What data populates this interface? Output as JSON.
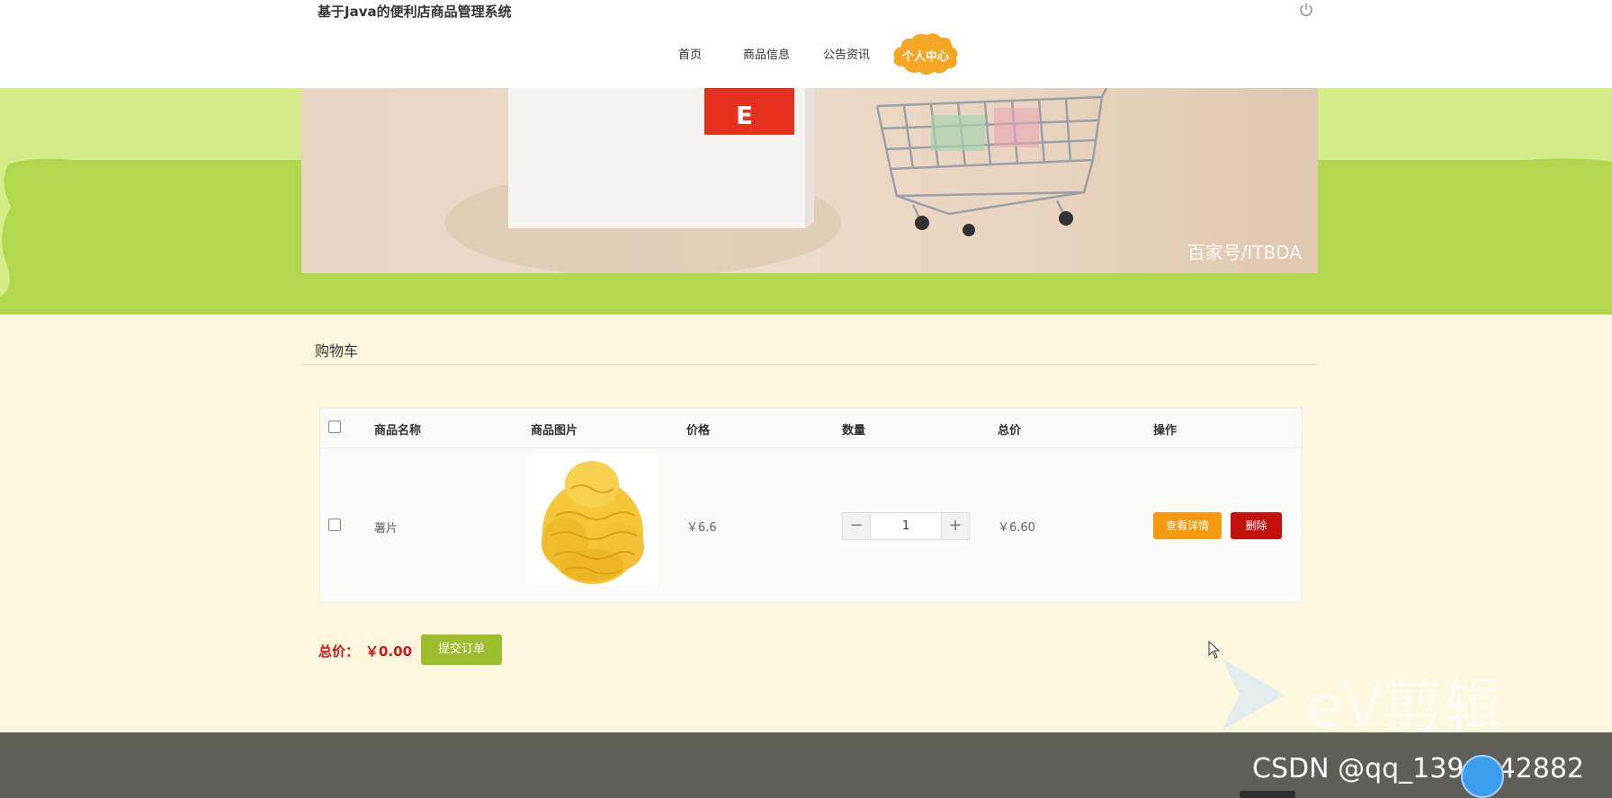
{
  "header": {
    "site_title": "基于Java的便利店商品管理系统",
    "nav": [
      {
        "label": "首页"
      },
      {
        "label": "商品信息"
      },
      {
        "label": "公告资讯"
      },
      {
        "label": "个人中心",
        "active": true
      }
    ],
    "power_icon": "power-icon"
  },
  "banner": {
    "watermark": "百家号/ITBDA"
  },
  "cart": {
    "title": "购物车",
    "columns": [
      "商品名称",
      "商品图片",
      "价格",
      "数量",
      "总价",
      "操作"
    ],
    "rows": [
      {
        "name": "薯片",
        "price": "￥6.6",
        "quantity": "1",
        "total": "￥6.60",
        "actions": {
          "detail": "查看详情",
          "delete": "删除"
        }
      }
    ],
    "stepper": {
      "minus": "−",
      "plus": "+"
    }
  },
  "summary": {
    "total_label": "总价：",
    "total_value": "￥0.00",
    "submit_label": "提交订单"
  },
  "overlay": {
    "csdn_watermark": "CSDN @qq_1394842882",
    "ev_text": "eV剪辑"
  },
  "colors": {
    "accent_orange": "#f59a0e",
    "delete_red": "#c4110c",
    "submit_green": "#9bbd2e",
    "band_green": "#b2d64e",
    "total_red": "#d0141b"
  }
}
